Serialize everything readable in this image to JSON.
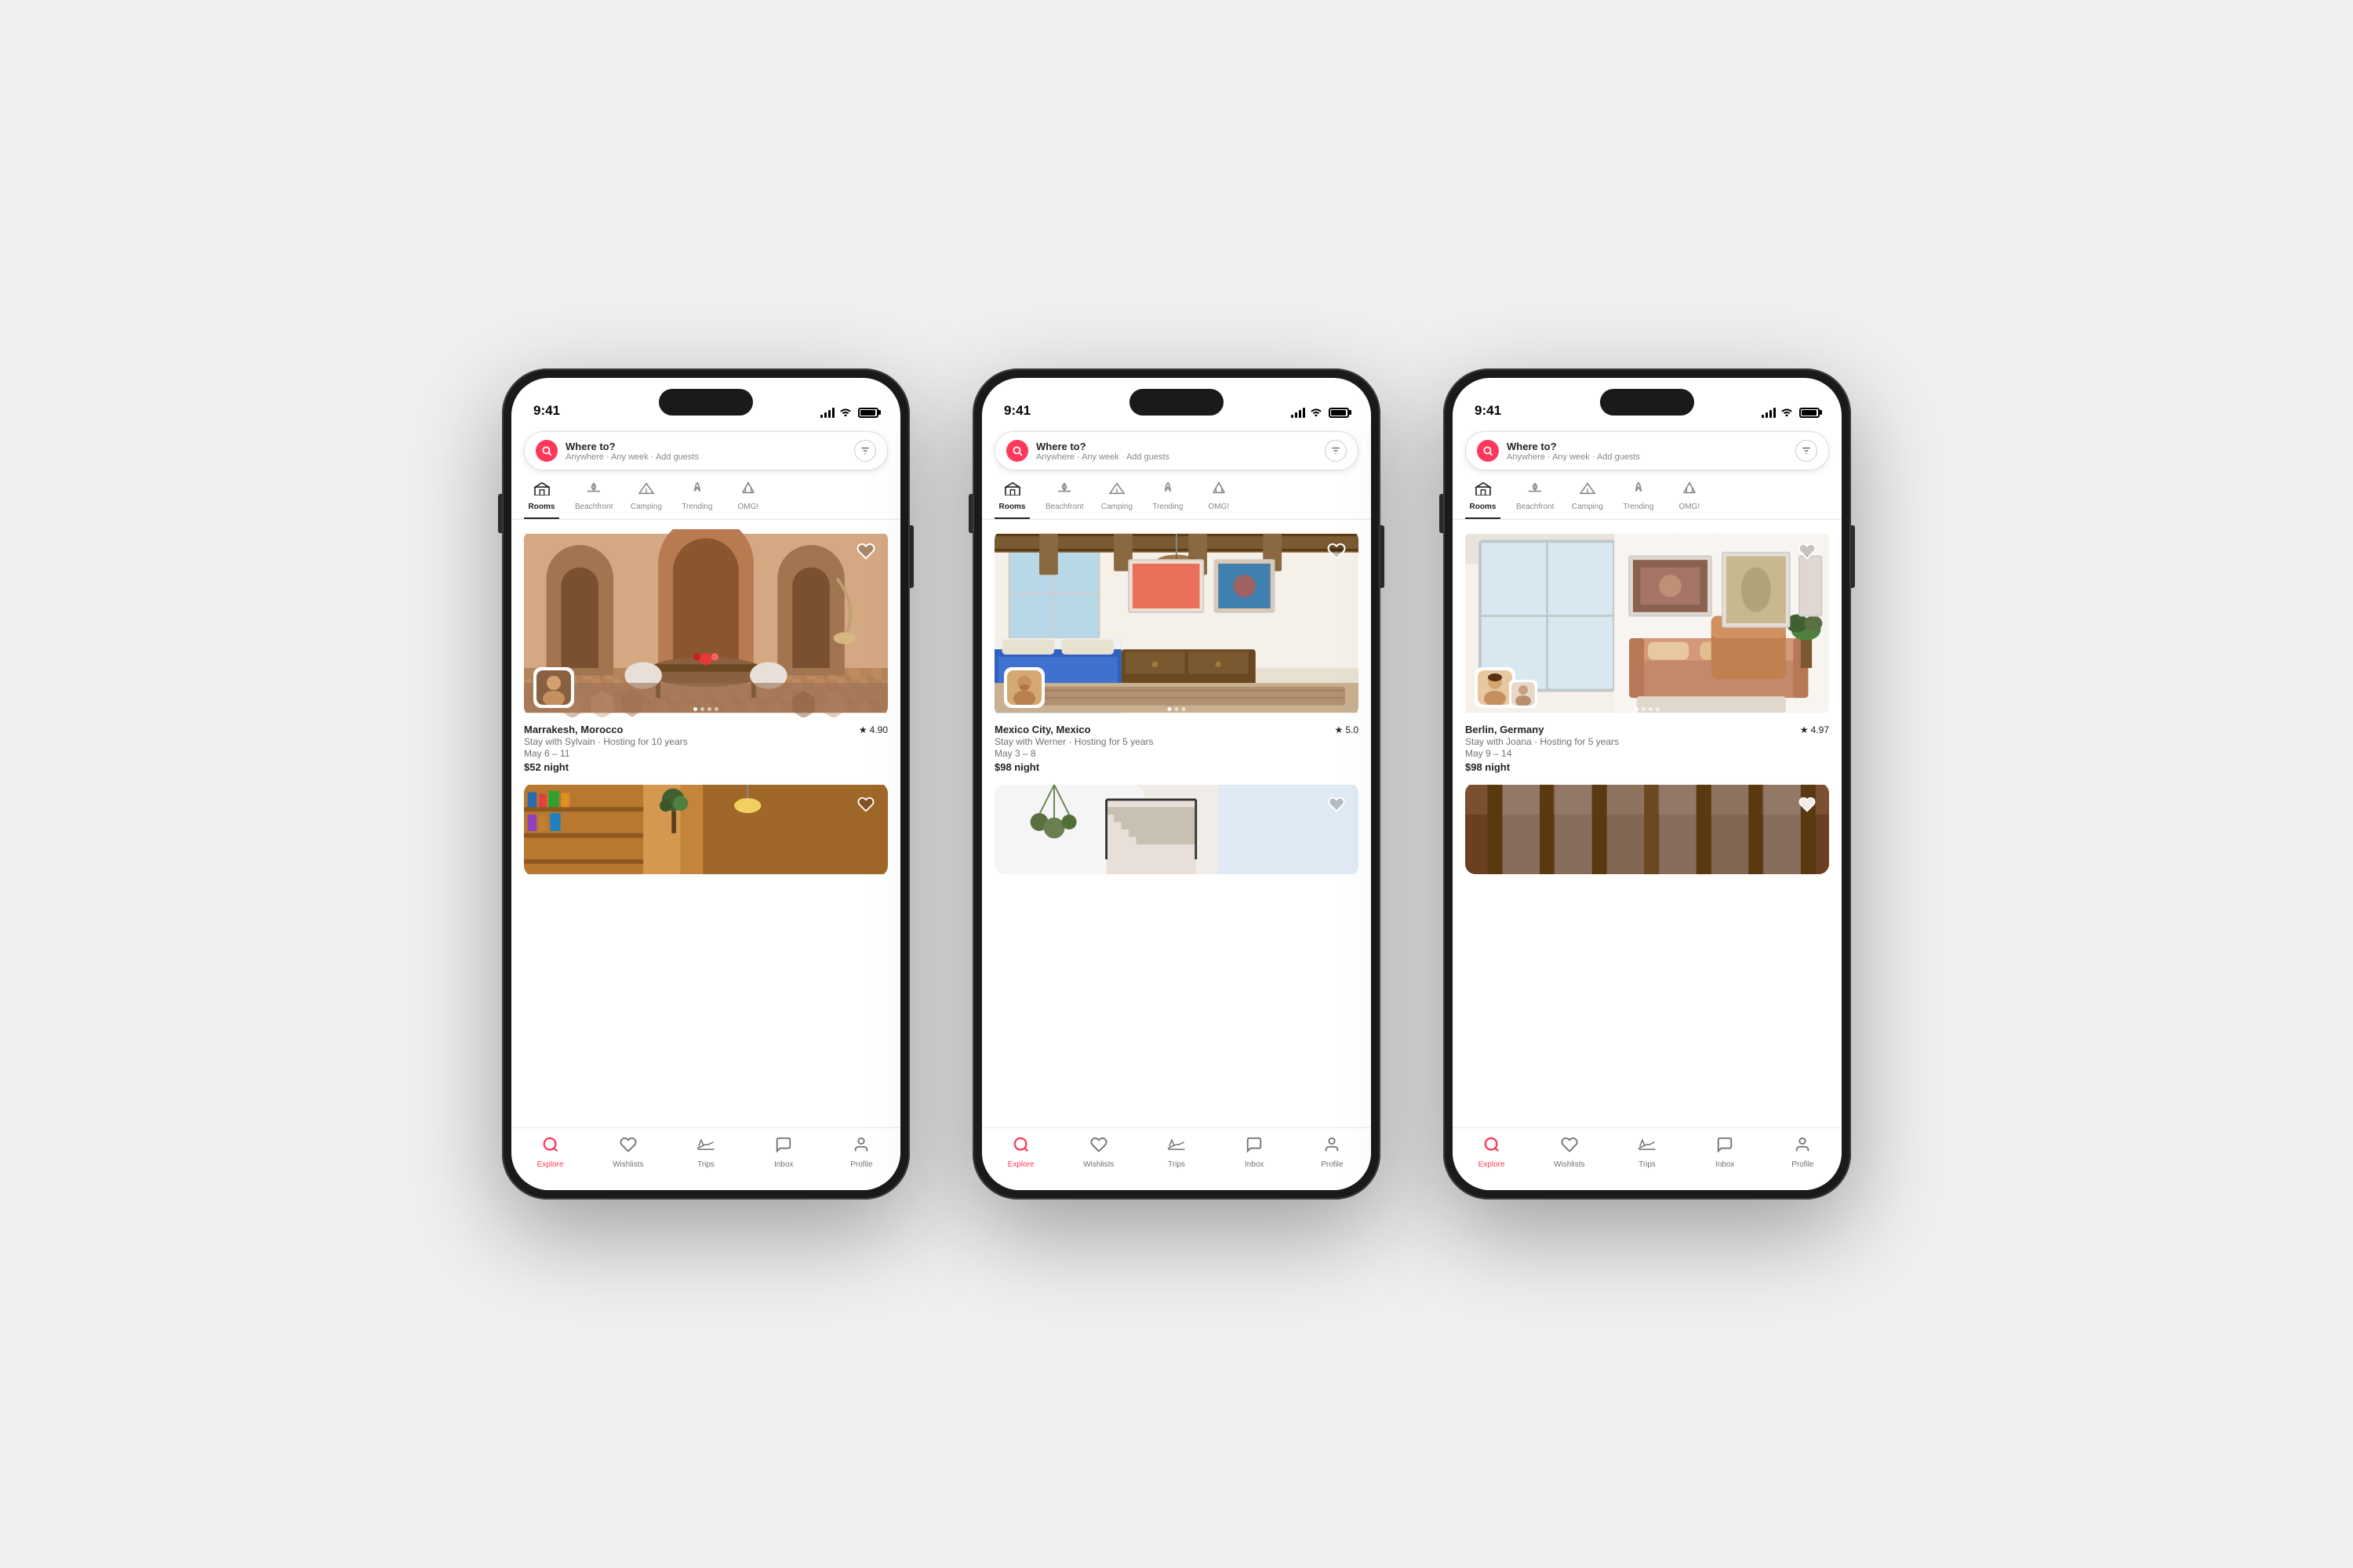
{
  "phones": [
    {
      "id": "phone1",
      "status": {
        "time": "9:41",
        "signal": [
          4,
          7,
          10,
          13
        ],
        "wifi": true,
        "battery": true
      },
      "search": {
        "placeholder": "Where to?",
        "subtitle": "Anywhere · Any week · Add guests"
      },
      "categories": [
        {
          "id": "rooms",
          "label": "Rooms",
          "icon": "🏠",
          "active": true
        },
        {
          "id": "beachfront",
          "label": "Beachfront",
          "icon": "🏖️",
          "active": false
        },
        {
          "id": "camping",
          "label": "Camping",
          "icon": "⛺",
          "active": false
        },
        {
          "id": "trending",
          "label": "Trending",
          "icon": "💧",
          "active": false
        },
        {
          "id": "omg",
          "label": "OMG!",
          "icon": "🏛️",
          "active": false
        }
      ],
      "listing": {
        "location": "Marrakesh, Morocco",
        "rating": "4.90",
        "host": "Stay with Sylvain · Hosting for 10 years",
        "dates": "May 6 – 11",
        "price": "$52 night",
        "color_scheme": "marrakesh"
      },
      "nav": [
        {
          "id": "explore",
          "label": "Explore",
          "icon": "🔍",
          "active": true
        },
        {
          "id": "wishlists",
          "label": "Wishlists",
          "icon": "♡",
          "active": false
        },
        {
          "id": "trips",
          "label": "Trips",
          "icon": "✈",
          "active": false
        },
        {
          "id": "inbox",
          "label": "Inbox",
          "icon": "💬",
          "active": false
        },
        {
          "id": "profile",
          "label": "Profile",
          "icon": "👤",
          "active": false
        }
      ]
    },
    {
      "id": "phone2",
      "status": {
        "time": "9:41",
        "signal": [
          4,
          7,
          10,
          13
        ],
        "wifi": true,
        "battery": true
      },
      "search": {
        "placeholder": "Where to?",
        "subtitle": "Anywhere · Any week · Add guests"
      },
      "categories": [
        {
          "id": "rooms",
          "label": "Rooms",
          "icon": "🏠",
          "active": true
        },
        {
          "id": "beachfront",
          "label": "Beachfront",
          "icon": "🏖️",
          "active": false
        },
        {
          "id": "camping",
          "label": "Camping",
          "icon": "⛺",
          "active": false
        },
        {
          "id": "trending",
          "label": "Trending",
          "icon": "💧",
          "active": false
        },
        {
          "id": "omg",
          "label": "OMG!",
          "icon": "🏛️",
          "active": false
        }
      ],
      "listing": {
        "location": "Mexico City, Mexico",
        "rating": "5.0",
        "host": "Stay with Werner · Hosting for 5 years",
        "dates": "May 3 – 8",
        "price": "$98 night",
        "color_scheme": "mexico"
      },
      "nav": [
        {
          "id": "explore",
          "label": "Explore",
          "icon": "🔍",
          "active": true
        },
        {
          "id": "wishlists",
          "label": "Wishlists",
          "icon": "♡",
          "active": false
        },
        {
          "id": "trips",
          "label": "Trips",
          "icon": "✈",
          "active": false
        },
        {
          "id": "inbox",
          "label": "Inbox",
          "icon": "💬",
          "active": false
        },
        {
          "id": "profile",
          "label": "Profile",
          "icon": "👤",
          "active": false
        }
      ]
    },
    {
      "id": "phone3",
      "status": {
        "time": "9:41",
        "signal": [
          4,
          7,
          10,
          13
        ],
        "wifi": true,
        "battery": true
      },
      "search": {
        "placeholder": "Where to?",
        "subtitle": "Anywhere · Any week · Add guests"
      },
      "categories": [
        {
          "id": "rooms",
          "label": "Rooms",
          "icon": "🏠",
          "active": true
        },
        {
          "id": "beachfront",
          "label": "Beachfront",
          "icon": "🏖️",
          "active": false
        },
        {
          "id": "camping",
          "label": "Camping",
          "icon": "⛺",
          "active": false
        },
        {
          "id": "trending",
          "label": "Trending",
          "icon": "💧",
          "active": false
        },
        {
          "id": "omg",
          "label": "OMG!",
          "icon": "🏛️",
          "active": false
        }
      ],
      "listing": {
        "location": "Berlin, Germany",
        "rating": "4.97",
        "host": "Stay with Joana · Hosting for 5 years",
        "dates": "May 9 – 14",
        "price": "$98 night",
        "color_scheme": "berlin"
      },
      "nav": [
        {
          "id": "explore",
          "label": "Explore",
          "icon": "🔍",
          "active": true
        },
        {
          "id": "wishlists",
          "label": "Wishlists",
          "icon": "♡",
          "active": false
        },
        {
          "id": "trips",
          "label": "Trips",
          "icon": "✈",
          "active": false
        },
        {
          "id": "inbox",
          "label": "Inbox",
          "icon": "💬",
          "active": false
        },
        {
          "id": "profile",
          "label": "Profile",
          "icon": "👤",
          "active": false
        }
      ]
    }
  ],
  "ui": {
    "search_icon": "🔍",
    "filter_icon": "⚙",
    "heart_icon": "♥",
    "star_icon": "★",
    "explore_label": "Explore",
    "wishlists_label": "Wishlists",
    "trips_label": "Trips",
    "inbox_label": "Inbox",
    "profile_label": "Profile"
  }
}
